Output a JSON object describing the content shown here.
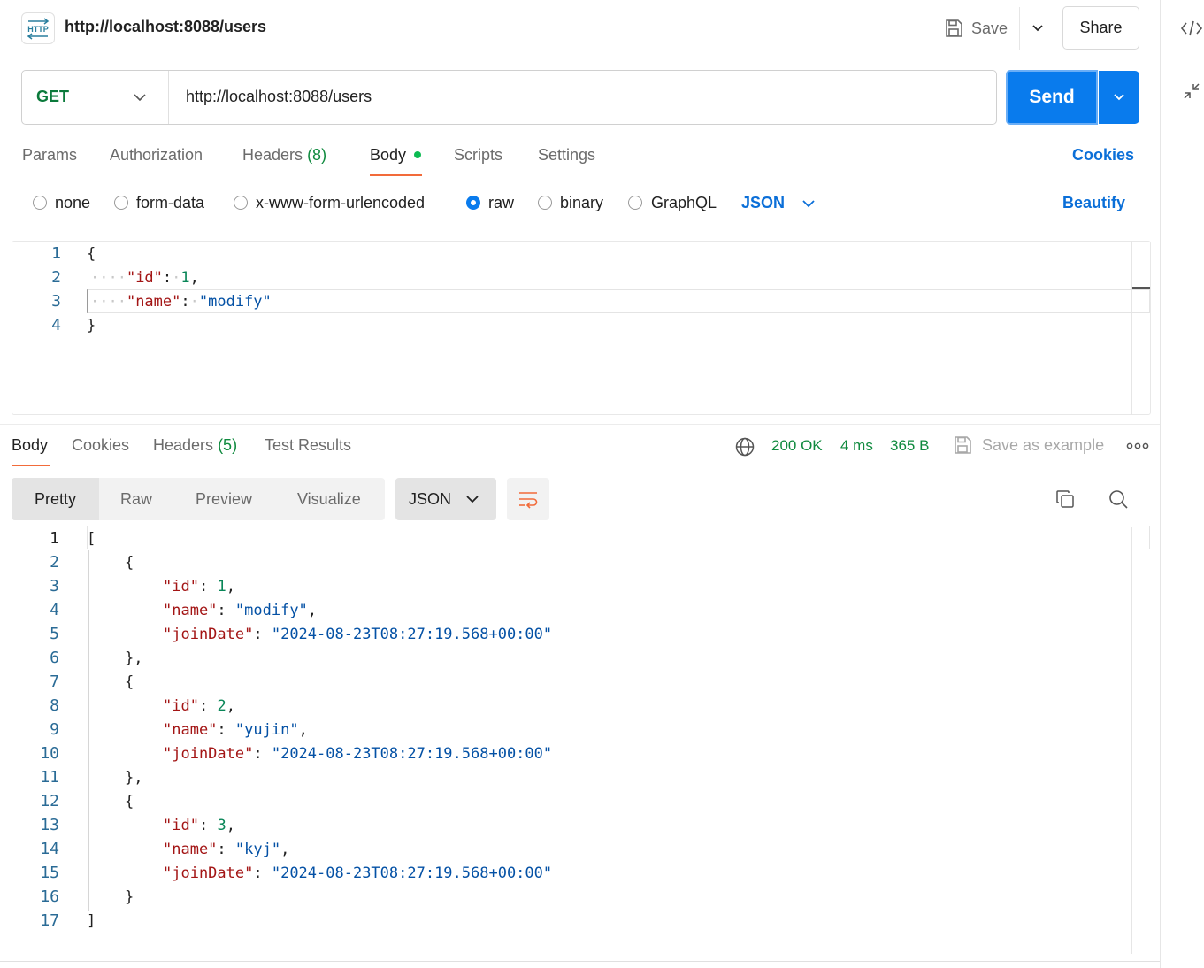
{
  "header": {
    "app_icon_text": "HTTP",
    "title": "http://localhost:8088/users",
    "save_label": "Save",
    "share_label": "Share"
  },
  "request": {
    "method": "GET",
    "url": "http://localhost:8088/users",
    "send_label": "Send"
  },
  "request_tabs": [
    {
      "label": "Params"
    },
    {
      "label": "Authorization"
    },
    {
      "label": "Headers",
      "count": "(8)"
    },
    {
      "label": "Body"
    },
    {
      "label": "Scripts"
    },
    {
      "label": "Settings"
    }
  ],
  "cookies_label": "Cookies",
  "body_types": [
    {
      "label": "none",
      "selected": false
    },
    {
      "label": "form-data",
      "selected": false
    },
    {
      "label": "x-www-form-urlencoded",
      "selected": false
    },
    {
      "label": "raw",
      "selected": true
    },
    {
      "label": "binary",
      "selected": false
    },
    {
      "label": "GraphQL",
      "selected": false
    }
  ],
  "raw_format": "JSON",
  "beautify_label": "Beautify",
  "request_body": {
    "line_numbers": [
      "1",
      "2",
      "3",
      "4"
    ],
    "open": "{",
    "close": "}",
    "id_key": "\"id\"",
    "id_value": "1",
    "name_key": "\"name\"",
    "name_value": "\"modify\""
  },
  "response_tabs": [
    {
      "label": "Body"
    },
    {
      "label": "Cookies"
    },
    {
      "label": "Headers",
      "count": "(5)"
    },
    {
      "label": "Test Results"
    }
  ],
  "response_meta": {
    "status": "200 OK",
    "time": "4 ms",
    "size": "365 B",
    "save_example_label": "Save as example"
  },
  "view_modes": [
    "Pretty",
    "Raw",
    "Preview",
    "Visualize"
  ],
  "response_format": "JSON",
  "response_body": {
    "line_numbers": [
      "1",
      "2",
      "3",
      "4",
      "5",
      "6",
      "7",
      "8",
      "9",
      "10",
      "11",
      "12",
      "13",
      "14",
      "15",
      "16",
      "17"
    ],
    "open": "[",
    "close": "]",
    "id_key": "\"id\"",
    "name_key": "\"name\"",
    "date_key": "\"joinDate\"",
    "items": [
      {
        "id": "1",
        "name": "\"modify\"",
        "joinDate": "\"2024-08-23T08:27:19.568+00:00\""
      },
      {
        "id": "2",
        "name": "\"yujin\"",
        "joinDate": "\"2024-08-23T08:27:19.568+00:00\""
      },
      {
        "id": "3",
        "name": "\"kyj\"",
        "joinDate": "\"2024-08-23T08:27:19.568+00:00\""
      }
    ]
  },
  "colors": {
    "send": "#097bed",
    "method": "#0b7a3b",
    "status": "#0f8a3e",
    "accent": "#f26b3a",
    "link": "#0b6fd8"
  }
}
